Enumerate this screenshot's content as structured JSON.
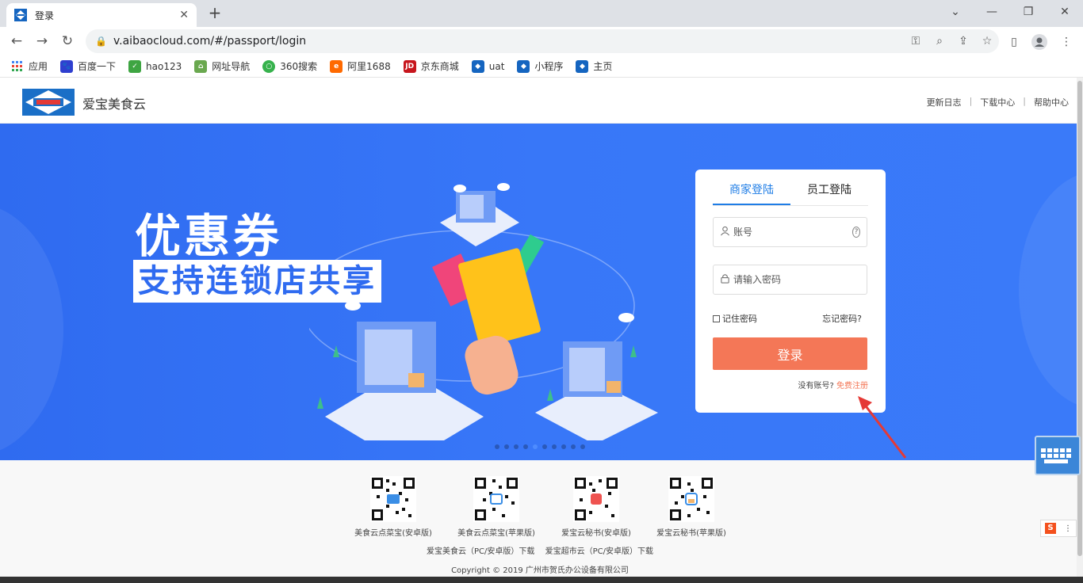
{
  "browser": {
    "tab_title": "登录",
    "url": "v.aibaocloud.com/#/passport/login",
    "bookmarks": [
      {
        "label": "应用",
        "icon": "apps-grid-icon",
        "color": "#4285f4"
      },
      {
        "label": "百度一下",
        "icon": "baidu-paw-icon",
        "color": "#2f3fcf"
      },
      {
        "label": "hao123",
        "icon": "hao123-icon",
        "color": "#3ea542"
      },
      {
        "label": "网址导航",
        "icon": "home-nav-icon",
        "color": "#6aa84f"
      },
      {
        "label": "360搜索",
        "icon": "360-search-icon",
        "color": "#37b24d"
      },
      {
        "label": "阿里1688",
        "icon": "alibaba-icon",
        "color": "#ff6a00"
      },
      {
        "label": "京东商城",
        "icon": "jd-icon",
        "color": "#c7161d"
      },
      {
        "label": "uat",
        "icon": "aibao-logo-icon",
        "color": "#1565c0"
      },
      {
        "label": "小程序",
        "icon": "aibao-logo-icon",
        "color": "#1565c0"
      },
      {
        "label": "主页",
        "icon": "aibao-logo-icon",
        "color": "#1565c0"
      }
    ]
  },
  "header": {
    "brand": "爱宝美食云",
    "links": [
      "更新日志",
      "下载中心",
      "帮助中心"
    ]
  },
  "hero": {
    "headline": "优惠券",
    "subheadline": "支持连锁店共享",
    "slides_count": 10,
    "active_slide": 5
  },
  "login": {
    "tabs": [
      {
        "label": "商家登陆",
        "active": true
      },
      {
        "label": "员工登陆",
        "active": false
      }
    ],
    "account_placeholder": "账号",
    "password_placeholder": "请输入密码",
    "remember_label": "记住密码",
    "forgot_label": "忘记密码?",
    "submit_label": "登录",
    "no_account_text": "没有账号?",
    "register_link": "免费注册"
  },
  "footer": {
    "qr_codes": [
      {
        "label": "美食云点菜宝(安卓版)"
      },
      {
        "label": "美食云点菜宝(苹果版)"
      },
      {
        "label": "爱宝云秘书(安卓版)"
      },
      {
        "label": "爱宝云秘书(苹果版)"
      }
    ],
    "downloads": "爱宝美食云（PC/安卓版）下载　 爱宝超市云（PC/安卓版）下载",
    "copyright": "Copyright © 2019 广州市贺氏办公设备有限公司"
  },
  "colors": {
    "hero_blue": "#3877f8",
    "login_button": "#f47757",
    "tab_active": "#1f7de6"
  }
}
